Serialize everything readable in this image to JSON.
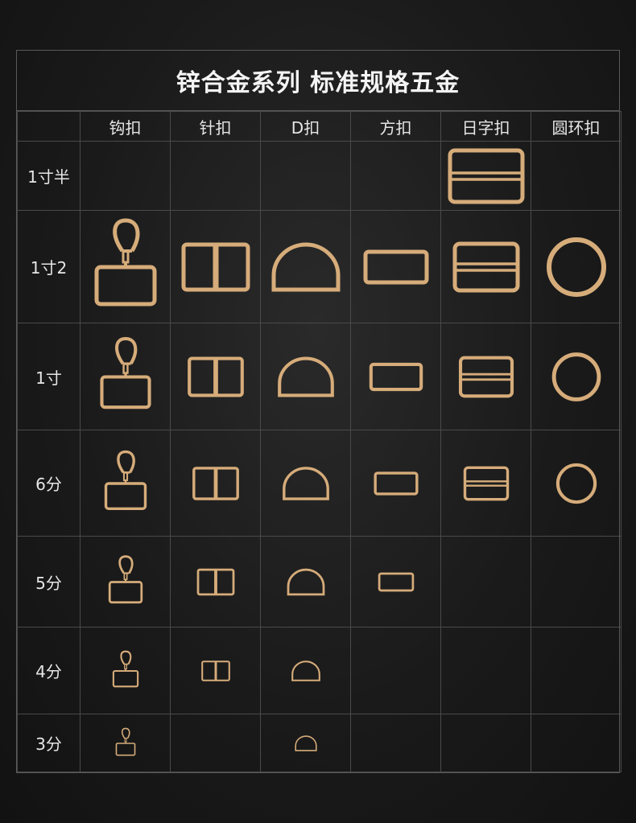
{
  "title": "锌合金系列 标准规格五金",
  "columns": [
    "钩扣",
    "针扣",
    "D扣",
    "方扣",
    "日字扣",
    "圆环扣"
  ],
  "rows": [
    {
      "label": "1寸半",
      "items": [
        "",
        "",
        "",
        "",
        "slide-buckle",
        ""
      ]
    },
    {
      "label": "1寸2",
      "items": [
        "snap-hook",
        "pin-buckle",
        "d-ring",
        "rectangle-ring",
        "slide-buckle",
        "o-ring"
      ]
    },
    {
      "label": "1寸",
      "items": [
        "snap-hook",
        "pin-buckle",
        "d-ring",
        "rectangle-ring",
        "slide-buckle",
        "o-ring"
      ]
    },
    {
      "label": "6分",
      "items": [
        "snap-hook",
        "pin-buckle",
        "d-ring",
        "rectangle-ring",
        "slide-buckle",
        "o-ring"
      ]
    },
    {
      "label": "5分",
      "items": [
        "snap-hook",
        "pin-buckle",
        "d-ring",
        "rectangle-ring",
        "",
        ""
      ]
    },
    {
      "label": "4分",
      "items": [
        "snap-hook",
        "pin-buckle",
        "d-ring",
        "",
        "",
        ""
      ]
    },
    {
      "label": "3分",
      "items": [
        "snap-hook",
        "",
        "d-ring",
        "",
        "",
        ""
      ]
    }
  ],
  "colors": {
    "gold": "#d6ac7a",
    "background": "#1c1c1c",
    "grid": "#4a4a4a"
  }
}
